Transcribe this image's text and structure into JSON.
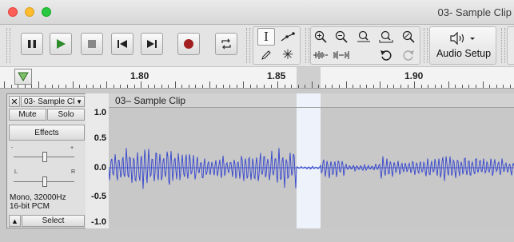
{
  "window": {
    "title": "03- Sample Clip"
  },
  "toolbar": {
    "audio_setup_label": "Audio Setup"
  },
  "ruler": {
    "labels": [
      "1.80",
      "1.85",
      "1.90"
    ]
  },
  "track": {
    "name": "03- Sample Cl",
    "mute": "Mute",
    "solo": "Solo",
    "effects": "Effects",
    "gain_minus": "-",
    "gain_plus": "+",
    "pan_left": "L",
    "pan_right": "R",
    "info_line1": "Mono, 32000Hz",
    "info_line2": "16-bit PCM",
    "select": "Select"
  },
  "vruler": {
    "labels": [
      "1.0",
      "0.5",
      "0.0",
      "-0.5",
      "-1.0"
    ]
  },
  "clip": {
    "name": "03– Sample Clip"
  },
  "colors": {
    "waveform": "#3344cc",
    "clip_bg": "#c8c8c8",
    "selection": "#eef3fb",
    "record": "#a32020",
    "play": "#2e8b2e"
  }
}
